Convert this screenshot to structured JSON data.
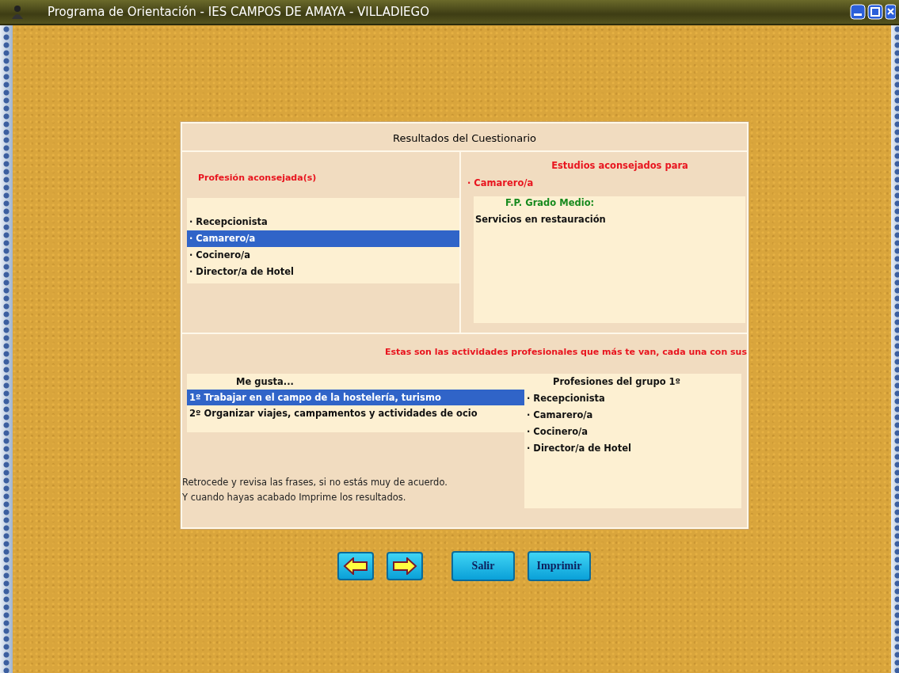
{
  "window": {
    "title": "Programa de Orientación -  IES CAMPOS DE AMAYA - VILLADIEGO"
  },
  "panel": {
    "title": "Resultados del Cuestionario",
    "professions": {
      "heading": "Profesión aconsejada(s)",
      "items": [
        {
          "label": "· Recepcionista",
          "selected": false
        },
        {
          "label": "· Camarero/a",
          "selected": true
        },
        {
          "label": "· Cocinero/a",
          "selected": false
        },
        {
          "label": "· Director/a de Hotel",
          "selected": false
        }
      ]
    },
    "studies": {
      "heading": "Estudios aconsejados para",
      "profession": "· Camarero/a",
      "level": "F.P. Grado Medio:",
      "items": [
        "Servicios en restauración"
      ]
    },
    "activities": {
      "intro": "Estas son las actividades profesionales que más te van, cada una con sus",
      "likes_heading": "Me gusta...",
      "likes": [
        {
          "label": "1º Trabajar en el campo de la hostelería, turismo",
          "selected": true
        },
        {
          "label": "2º Organizar viajes, campamentos y actividades de ocio",
          "selected": false
        }
      ],
      "group_heading": "Profesiones del grupo 1º",
      "group_items": [
        "· Recepcionista",
        "· Camarero/a",
        "· Cocinero/a",
        "· Director/a de Hotel"
      ],
      "notes": [
        "Retrocede y revisa las frases, si no estás muy de acuerdo.",
        "Y cuando hayas acabado Imprime los resultados."
      ]
    }
  },
  "buttons": [
    {
      "kind": "back"
    },
    {
      "kind": "forward"
    },
    {
      "kind": "text",
      "label": "Salir"
    },
    {
      "kind": "text",
      "label": "Imprimir"
    }
  ]
}
